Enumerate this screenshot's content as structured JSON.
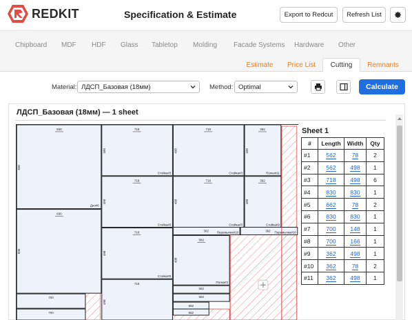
{
  "app": {
    "brand": "REDKIT",
    "title": "Specification & Estimate",
    "actions": {
      "export_label": "Export to Redcut",
      "refresh_label": "Refresh List",
      "settings_icon": "gear-icon"
    }
  },
  "categories": [
    "Chipboard",
    "MDF",
    "HDF",
    "Glass",
    "Tabletop",
    "Molding",
    "Facade Systems",
    "Hardware",
    "Other"
  ],
  "tabs": [
    {
      "label": "Estimate",
      "active": false
    },
    {
      "label": "Price List",
      "active": false
    },
    {
      "label": "Cutting",
      "active": true
    },
    {
      "label": "Remnants",
      "active": false
    }
  ],
  "controls": {
    "material_label": "Material:",
    "material_value": "ЛДСП_Базовая (18мм)",
    "method_label": "Method:",
    "method_value": "Optimal",
    "print_icon": "printer-icon",
    "panel_icon": "panel-toggle-icon",
    "calculate_label": "Calculate"
  },
  "sheet": {
    "heading": "ЛДСП_Базовая (18мм) — 1 sheet",
    "label": "Sheet 1",
    "columns": [
      "#",
      "Length",
      "Width",
      "Qty"
    ],
    "rows": [
      {
        "id": "#1",
        "length": "562",
        "width": "78",
        "qty": "2"
      },
      {
        "id": "#2",
        "length": "562",
        "width": "498",
        "qty": "1"
      },
      {
        "id": "#3",
        "length": "718",
        "width": "498",
        "qty": "6"
      },
      {
        "id": "#4",
        "length": "830",
        "width": "830",
        "qty": "1"
      },
      {
        "id": "#5",
        "length": "662",
        "width": "78",
        "qty": "2"
      },
      {
        "id": "#6",
        "length": "830",
        "width": "830",
        "qty": "1"
      },
      {
        "id": "#7",
        "length": "700",
        "width": "148",
        "qty": "1"
      },
      {
        "id": "#8",
        "length": "700",
        "width": "166",
        "qty": "1"
      },
      {
        "id": "#9",
        "length": "362",
        "width": "498",
        "qty": "1"
      },
      {
        "id": "#10",
        "length": "362",
        "width": "78",
        "qty": "2"
      },
      {
        "id": "#11",
        "length": "362",
        "width": "498",
        "qty": "1"
      }
    ]
  },
  "diagram": {
    "add_icon": "plus-icon",
    "panels": [
      {
        "top": "830",
        "side": "830",
        "tag": "Дно#6"
      },
      {
        "top": "830",
        "side": "830",
        "tag": ""
      },
      {
        "top": "718",
        "side": "498",
        "tag": "Стойка#3"
      },
      {
        "top": "718",
        "side": "498",
        "tag": "Стойка#3"
      },
      {
        "top": "718",
        "side": "498",
        "tag": "Стойка#3"
      },
      {
        "top": "718",
        "side": "498",
        "tag": "Стойка#3"
      },
      {
        "top": "718",
        "side": "498",
        "tag": "Стойка#3"
      },
      {
        "top": "718",
        "side": "498",
        "tag": "Стойка#3"
      },
      {
        "top": "362",
        "side": "498",
        "tag": "Полка#11"
      },
      {
        "top": "362",
        "side": "498",
        "tag": "Стойка#9"
      },
      {
        "top": "700",
        "side": "148",
        "tag": "Полка#7"
      },
      {
        "top": "700",
        "side": "166",
        "tag": "Полка#8"
      },
      {
        "top": "562",
        "side": "498",
        "tag": "Полка#2"
      },
      {
        "top": "562",
        "side": "",
        "tag": "Планка#1"
      },
      {
        "top": "562",
        "side": "",
        "tag": "Планка#1"
      },
      {
        "top": "362",
        "side": "",
        "tag": "Перемычка#10"
      },
      {
        "top": "362",
        "side": "",
        "tag": "Перемычка#10"
      },
      {
        "top": "662",
        "side": "",
        "tag": "Планка#5"
      },
      {
        "top": "662",
        "side": "",
        "tag": "Планка#5"
      },
      {
        "top": "",
        "side": "",
        "tag": "Перемычка#5"
      }
    ]
  },
  "colors": {
    "accent": "#1f6fe0",
    "tab_orange": "#e0812a",
    "link": "#1f66d6",
    "offcut": "#e04848",
    "panel_fill": "#eef2fb"
  }
}
